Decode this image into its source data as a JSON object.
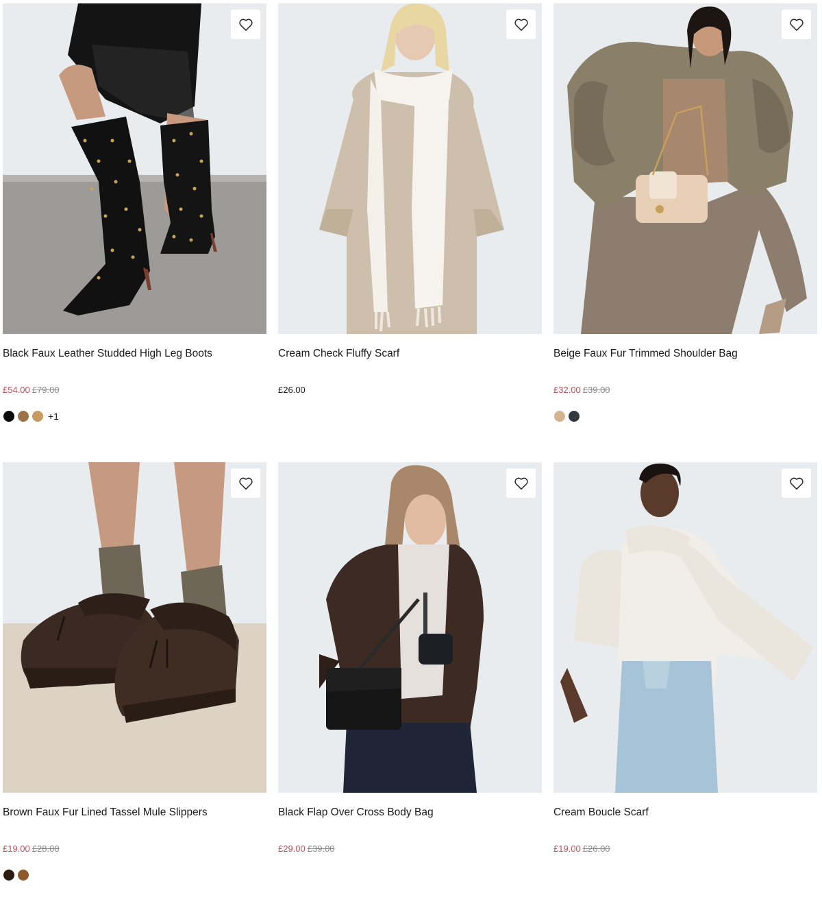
{
  "products": [
    {
      "title": "Black Faux Leather Studded High Leg Boots",
      "price_now": "£54.00",
      "price_was": "£79.00",
      "swatches": [
        "#0b0b0b",
        "#9b7448",
        "#c79a5e"
      ],
      "more_swatches": "+1"
    },
    {
      "title": "Cream Check Fluffy Scarf",
      "price_now": "£26.00",
      "price_was": "",
      "swatches": [],
      "more_swatches": ""
    },
    {
      "title": "Beige Faux Fur Trimmed Shoulder Bag",
      "price_now": "£32.00",
      "price_was": "£39.00",
      "swatches": [
        "#d3b48e",
        "#323a40"
      ],
      "more_swatches": ""
    },
    {
      "title": "Brown Faux Fur Lined Tassel Mule Slippers",
      "price_now": "£19.00",
      "price_was": "£28.00",
      "swatches": [
        "#2a1a10",
        "#8e5a2a"
      ],
      "more_swatches": ""
    },
    {
      "title": "Black Flap Over Cross Body Bag",
      "price_now": "£29.00",
      "price_was": "£39.00",
      "swatches": [],
      "more_swatches": ""
    },
    {
      "title": "Cream Boucle Scarf",
      "price_now": "£19.00",
      "price_was": "£26.00",
      "swatches": [],
      "more_swatches": ""
    }
  ],
  "colors": {
    "sale_price": "#c0505a",
    "was_price": "#8a8a8a",
    "text": "#1a1a1a"
  },
  "icons": {
    "wishlist": "heart-outline-icon"
  }
}
